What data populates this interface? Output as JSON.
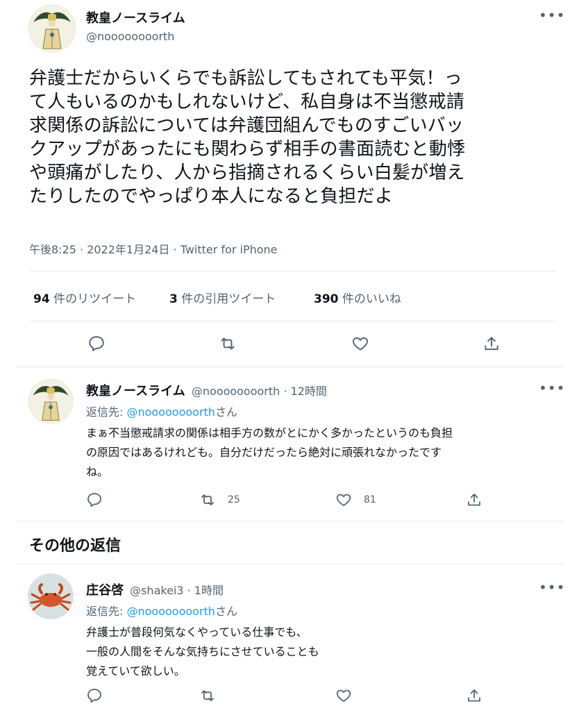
{
  "main_tweet": {
    "author_name": "教皇ノースライム",
    "handle": "@noooooooorth",
    "text": "弁護士だからいくらでも訴訟してもされても平気！って人もいるのかもしれないけど、私自身は不当懲戒請求関係の訴訟については弁護団組んでものすごいバックアップがあったにも関わらず相手の書面読むと動悸や頭痛がしたり、人から指摘されるくらい白髪が増えたりしたのでやっぱり本人になると負担だよ",
    "text_lines": [
      "弁護士だからいくらでも訴訟してもされても平気！っ",
      "て人もいるのかもしれないけど、私自身は不当懲戒請",
      "求関係の訴訟については弁護団組んでものすごいバッ",
      "クアップがあったにも関わらず相手の書面読むと動悸",
      "や頭痛がしたり、人から指摘されるくらい白髪が増え",
      "たりしたのでやっぱり本人になると負担だよ"
    ],
    "time": "午後8:25 · 2022年1月24日 · Twitter for iPhone",
    "stats": {
      "retweets_count": "94",
      "retweets_label": " 件のリツイート",
      "quotes_count": "3",
      "quotes_label": " 件の引用ツイート",
      "likes_count": "390",
      "likes_label": " 件のいいね"
    }
  },
  "reply1": {
    "author_name": "教皇ノースライム",
    "handle_time": "@noooooooorth · 12時間",
    "reply_prefix": "返信先: ",
    "reply_mention": "@noooooooorth",
    "reply_suffix": "さん",
    "text_lines": [
      "まぁ不当懲戒請求の関係は相手方の数がとにかく多かったというのも負担",
      "の原因ではあるけれども。自分だけだったら絶対に頑張れなかったです",
      "ね。"
    ],
    "retweets": "25",
    "likes": "81"
  },
  "section_title": "その他の返信",
  "reply2": {
    "author_name": "庄谷啓",
    "handle_time": "@shakei3 · 1時間",
    "reply_prefix": "返信先: ",
    "reply_mention": "@noooooooorth",
    "reply_suffix": "さん",
    "text_lines": [
      "弁護士が普段何気なくやっている仕事でも、",
      "一般の人間をそんな気持ちにさせていることも",
      "覚えていて欲しい。"
    ]
  },
  "colors": {
    "text": "#0f1419",
    "secondary": "#536471",
    "link": "#1d9bf0",
    "divider": "#e6ecf0"
  },
  "icons": [
    "more-icon",
    "reply-icon",
    "retweet-icon",
    "like-icon",
    "share-icon"
  ]
}
